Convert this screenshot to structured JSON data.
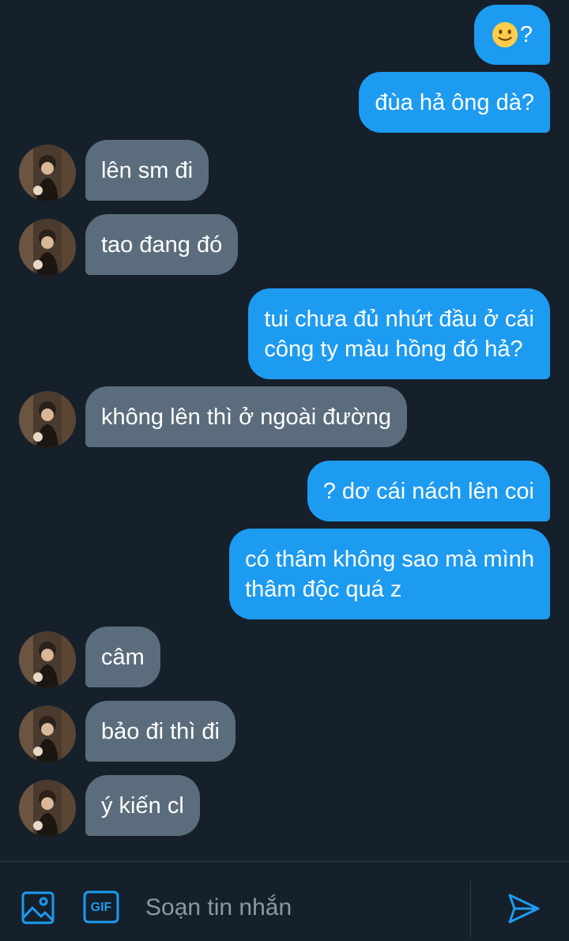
{
  "conversation": {
    "messages": [
      {
        "side": "sent",
        "text": "?",
        "has_emoji": true,
        "emoji": "slightly-smiling-face"
      },
      {
        "side": "sent",
        "text": "đùa hả ông dà?"
      },
      {
        "side": "received",
        "text": "lên sm đi"
      },
      {
        "side": "received",
        "text": "tao đang đó"
      },
      {
        "side": "sent",
        "text": "tui chưa đủ nhứt đầu ở cái\ncông ty màu hồng đó hả?"
      },
      {
        "side": "received",
        "text": "không lên thì ở ngoài đường"
      },
      {
        "side": "sent",
        "text": "? dơ cái nách lên coi"
      },
      {
        "side": "sent",
        "text": "có thâm không sao mà mình\nthâm độc quá z"
      },
      {
        "side": "received",
        "text": "câm"
      },
      {
        "side": "received",
        "text": "bảo đi thì đi"
      },
      {
        "side": "received",
        "text": "ý kiến cl"
      }
    ]
  },
  "composer": {
    "placeholder": "Soạn tin nhắn",
    "gif_label": "GIF",
    "icons": [
      "image-icon",
      "gif-icon",
      "send-icon"
    ]
  },
  "colors": {
    "background": "#15202b",
    "sent_bubble": "#1d9bf0",
    "received_bubble": "#5b6d7c",
    "accent": "#1d9bf0",
    "placeholder": "#8b98a5"
  }
}
